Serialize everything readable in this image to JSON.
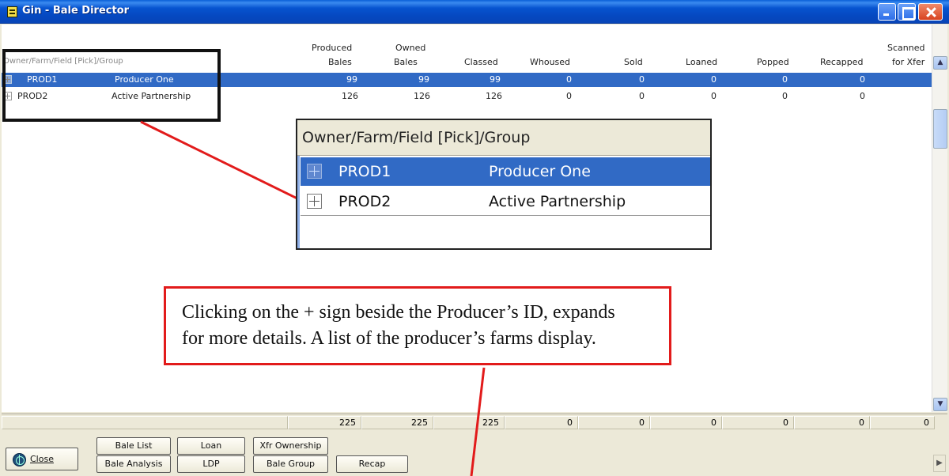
{
  "window": {
    "title": "Gin - Bale Director",
    "title_icon": "app-icon",
    "controls": [
      "minimize-icon",
      "maximize-icon",
      "close-icon"
    ]
  },
  "grid": {
    "first_header": "Owner/Farm/Field [Pick]/Group",
    "columns": [
      {
        "line1": "Produced",
        "line2": "Bales"
      },
      {
        "line1": "Owned",
        "line2": "Bales"
      },
      {
        "line1": "",
        "line2": "Classed"
      },
      {
        "line1": "",
        "line2": "Whoused"
      },
      {
        "line1": "",
        "line2": "Sold"
      },
      {
        "line1": "",
        "line2": "Loaned"
      },
      {
        "line1": "",
        "line2": "Popped"
      },
      {
        "line1": "",
        "line2": "Recapped"
      },
      {
        "line1": "Scanned",
        "line2": "for Xfer"
      }
    ],
    "rows": [
      {
        "id": "PROD1",
        "name": "Producer One",
        "selected": true,
        "values": [
          "99",
          "99",
          "99",
          "0",
          "0",
          "0",
          "0",
          "0"
        ]
      },
      {
        "id": "PROD2",
        "name": "Active Partnership",
        "selected": false,
        "values": [
          "126",
          "126",
          "126",
          "0",
          "0",
          "0",
          "0",
          "0"
        ]
      }
    ],
    "totals": [
      "225",
      "225",
      "225",
      "0",
      "0",
      "0",
      "0",
      "0",
      "0"
    ]
  },
  "buttons": {
    "close": "Close",
    "bale_list": "Bale List",
    "bale_analysis": "Bale Analysis",
    "loan": "Loan",
    "ldp": "LDP",
    "xfr_ownership": "Xfr Ownership",
    "bale_group": "Bale Group",
    "recap": "Recap"
  },
  "magnified": {
    "header": "Owner/Farm/Field [Pick]/Group",
    "rows": [
      {
        "id": "PROD1",
        "name": "Producer One"
      },
      {
        "id": "PROD2",
        "name": "Active Partnership"
      }
    ]
  },
  "callout": {
    "line1": "Clicking on the + sign beside the Producer’s ID, expands",
    "line2": "for more details.  A list of the producer’s farms display."
  },
  "colors": {
    "selection": "#316ac5",
    "annotation_red": "#e21b1b",
    "titlebar": "#0754d0"
  }
}
